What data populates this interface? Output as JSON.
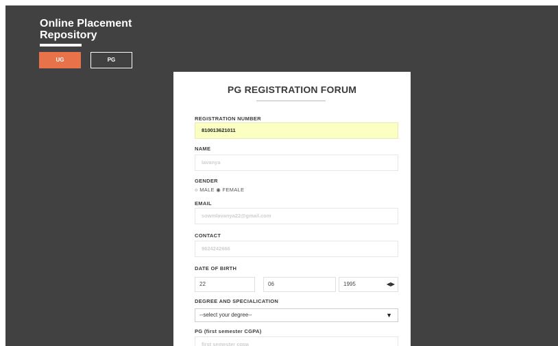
{
  "brand": {
    "line1": "Online Placement",
    "line2": "Repository"
  },
  "toggles": {
    "ug": "UG",
    "pg": "PG"
  },
  "form": {
    "title": "PG REGISTRATION FORUM",
    "registration": {
      "label": "REGISTRATION NUMBER",
      "value": "810013621011"
    },
    "name": {
      "label": "NAME",
      "value": "lavanya"
    },
    "gender": {
      "label": "GENDER",
      "male": "MALE",
      "female": "FEMALE",
      "selected": "female"
    },
    "email": {
      "label": "EMAIL",
      "value": "sowmlavanya22@gmail.com"
    },
    "contact": {
      "label": "CONTACT",
      "value": "9624242666"
    },
    "dob": {
      "label": "DATE OF BIRTH",
      "day": "22",
      "month": "06",
      "year": "1995"
    },
    "degree": {
      "label": "DEGREE AND SPECIALICATION",
      "value": "--select your degree--"
    },
    "cgpa": {
      "label": "PG (first semester CGPA)",
      "placeholder": "first semester cgpa"
    }
  },
  "colors": {
    "background": "#414141",
    "accent": "#e8734a",
    "autofill": "#fbffc2"
  },
  "icons": {
    "radio_unselected": "○",
    "radio_selected": "◉",
    "dropdown": "▼",
    "spinner": "◀▶"
  }
}
